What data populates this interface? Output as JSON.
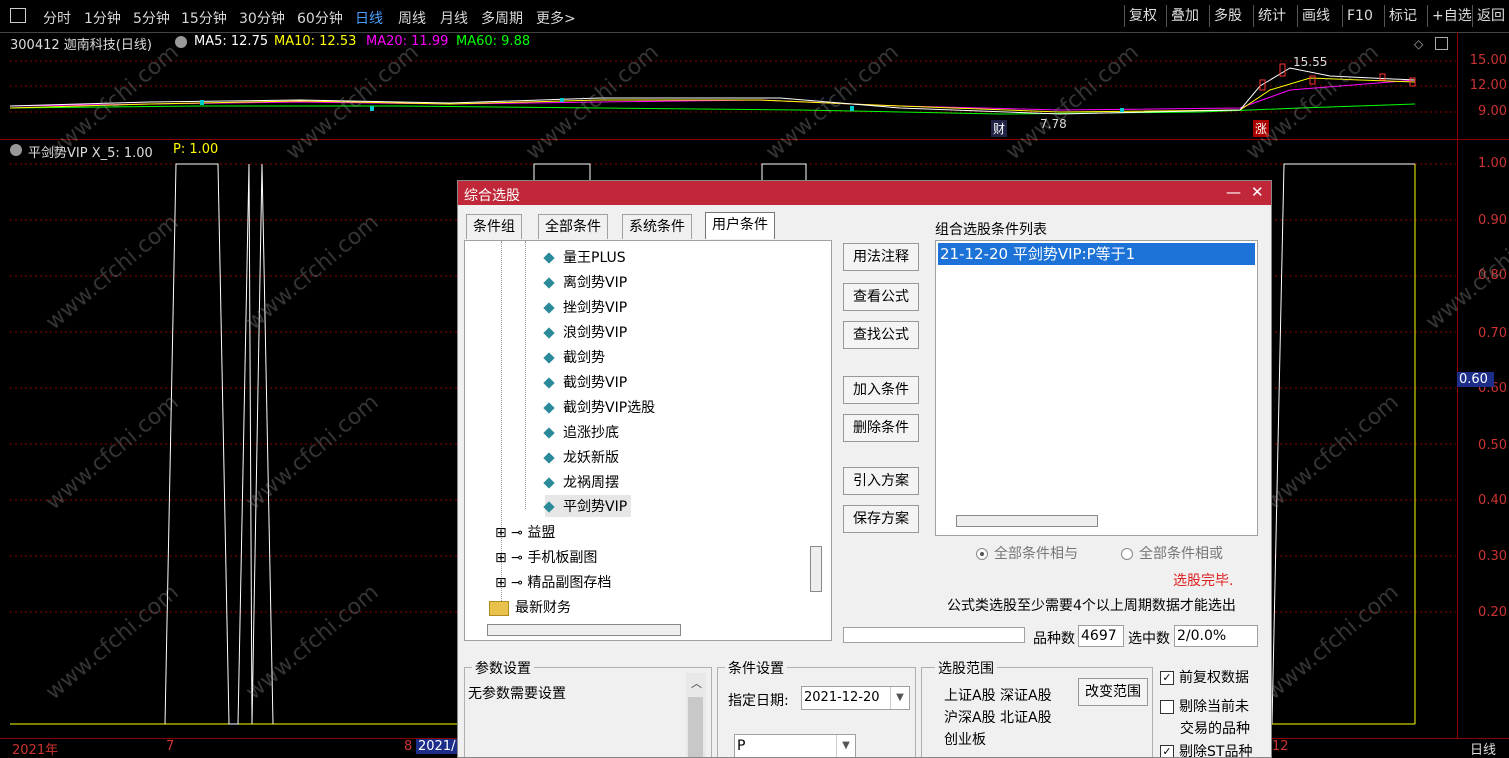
{
  "toolbar": {
    "periods": [
      "分时",
      "1分钟",
      "5分钟",
      "15分钟",
      "30分钟",
      "60分钟",
      "日线",
      "周线",
      "月线",
      "多周期",
      "更多>"
    ],
    "active_period": "日线",
    "right_buttons": [
      "复权",
      "叠加",
      "多股",
      "统计",
      "画线",
      "F10",
      "标记",
      "+自选",
      "返回"
    ]
  },
  "stock": {
    "title": "300412 迦南科技(日线)",
    "ma5": "MA5: 12.75",
    "ma10": "MA10: 12.53",
    "ma20": "MA20: 11.99",
    "ma60": "MA60: 9.88",
    "high_label": "15.55",
    "low_label": "7.78",
    "cai_badge": "财",
    "zhang_badge": "涨"
  },
  "upper_axis": [
    "15.00",
    "12.00",
    "9.00"
  ],
  "indicator": {
    "title": "平剑势VIP X_5: 1.00",
    "p_value": "P: 1.00",
    "axis": [
      "1.00",
      "0.90",
      "0.80",
      "0.70",
      "0.60",
      "0.50",
      "0.40",
      "0.30",
      "0.20"
    ],
    "current": "0.60"
  },
  "date_axis": {
    "year": "2021年",
    "m7": "7",
    "m8": "8",
    "highlight": "2021/",
    "m12": "12",
    "period": "日线"
  },
  "watermark": "www.cfchi.com",
  "colors": {
    "ma5": "#ffffff",
    "ma10": "#ffff00",
    "ma20": "#ff00ff",
    "ma60": "#00ff00",
    "title_bar": "#c0283a",
    "selected": "#1c72d6",
    "axis": "#cc3333",
    "indicator": "#ffff00"
  },
  "dialog": {
    "title": "综合选股",
    "tabs": [
      "条件组",
      "全部条件",
      "系统条件",
      "用户条件"
    ],
    "selected_tab": "用户条件",
    "tree_items": [
      "量王PLUS",
      "离剑势VIP",
      "挫剑势VIP",
      "浪剑势VIP",
      "截剑势",
      "截剑势VIP",
      "截剑势VIP选股",
      "追涨抄底",
      "龙妖新版",
      "龙祸周摆",
      "平剑势VIP"
    ],
    "tree_groups": [
      "益盟",
      "手机板副图",
      "精品副图存档"
    ],
    "tree_folder": "最新财务",
    "buttons": [
      "用法注释",
      "查看公式",
      "查找公式",
      "加入条件",
      "删除条件",
      "引入方案",
      "保存方案"
    ],
    "list_title": "组合选股条件列表",
    "list_items": [
      "21-12-20 平剑势VIP:P等于1"
    ],
    "radio_and": "全部条件相与",
    "radio_or": "全部条件相或",
    "status": "选股完毕.",
    "hint": "公式类选股至少需要4个以上周期数据才能选出",
    "count_label": "品种数",
    "count_value": "4697",
    "selected_label": "选中数",
    "selected_value": "2/0.0%",
    "param_title": "参数设置",
    "param_text": "无参数需要设置",
    "cond_title": "条件设置",
    "date_label": "指定日期:",
    "date_value": "2021-12-20",
    "p_select": "P",
    "range_title": "选股范围",
    "range_text": [
      "上证A股 深证A股",
      "沪深A股 北证A股",
      "创业板"
    ],
    "change_range": "改变范围",
    "checks": [
      {
        "label": "前复权数据",
        "checked": true
      },
      {
        "label": "剔除当前未",
        "checked": false
      },
      {
        "label": "交易的品种",
        "checked": false
      },
      {
        "label": "剔除ST品种",
        "checked": true
      }
    ]
  }
}
